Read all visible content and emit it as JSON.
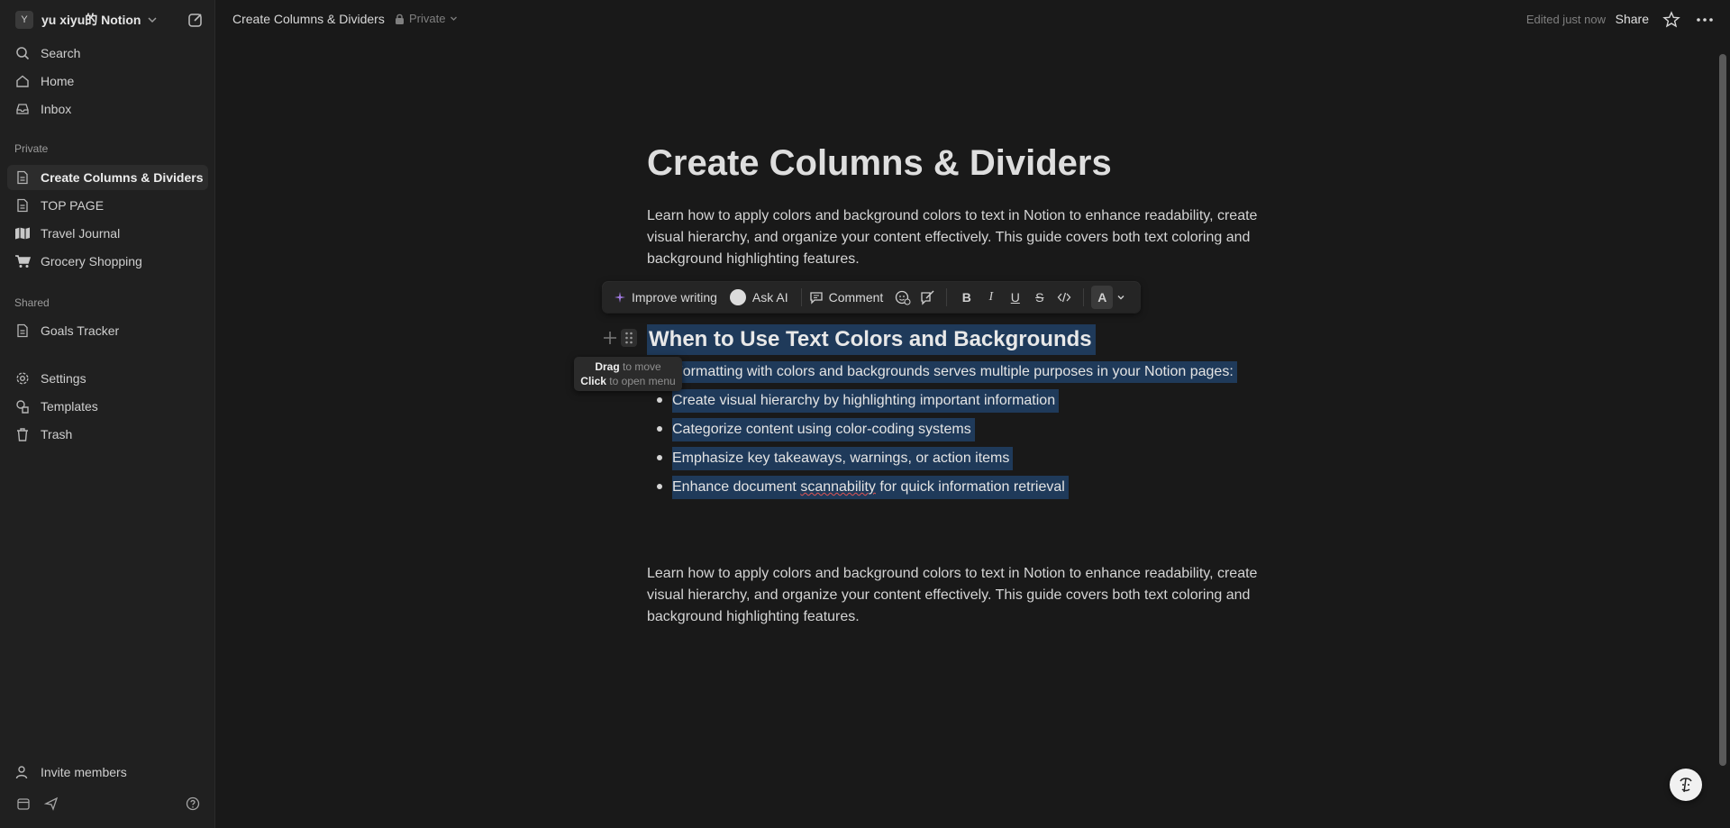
{
  "workspace": {
    "avatar_letter": "Y",
    "name": "yu xiyu的 Notion"
  },
  "sidebar": {
    "top_items": [
      {
        "label": "Search",
        "icon": "search-icon"
      },
      {
        "label": "Home",
        "icon": "home-icon"
      },
      {
        "label": "Inbox",
        "icon": "inbox-icon"
      }
    ],
    "private_label": "Private",
    "private_items": [
      {
        "label": "Create Columns & Dividers",
        "icon": "page-icon",
        "active": true
      },
      {
        "label": "TOP PAGE",
        "icon": "page-icon"
      },
      {
        "label": "Travel Journal",
        "icon": "map-icon"
      },
      {
        "label": "Grocery Shopping",
        "icon": "cart-icon"
      }
    ],
    "shared_label": "Shared",
    "shared_items": [
      {
        "label": "Goals Tracker",
        "icon": "page-icon"
      }
    ],
    "bottom_items": [
      {
        "label": "Settings",
        "icon": "gear-icon"
      },
      {
        "label": "Templates",
        "icon": "templates-icon"
      },
      {
        "label": "Trash",
        "icon": "trash-icon"
      }
    ],
    "invite_label": "Invite members"
  },
  "topbar": {
    "breadcrumb": "Create Columns & Dividers",
    "privacy": "Private",
    "edited": "Edited just now",
    "share": "Share"
  },
  "page": {
    "title": "Create Columns & Dividers",
    "intro_line1": "Learn how to apply colors and background colors to text in Notion to enhance readability, create",
    "intro_line2": "visual hierarchy, and organize your content effectively. This guide covers both text coloring and",
    "intro_line3": "background highlighting features.",
    "heading": "When to Use Text Colors and Backgrounds",
    "selected_intro": "Formatting with colors and backgrounds serves multiple purposes in your Notion pages:",
    "bullets": [
      "Create visual hierarchy by highlighting important information",
      "Categorize content using color-coding systems",
      "Emphasize key takeaways, warnings, or action items"
    ],
    "bullet4_a": "Enhance document ",
    "bullet4_b": "scannability",
    "bullet4_c": " for quick information retrieval",
    "outro_line1": "Learn how to apply colors and background colors to text in Notion to enhance readability, create",
    "outro_line2": "visual hierarchy, and organize your content effectively. This guide covers both text coloring and",
    "outro_line3": "background highlighting features."
  },
  "toolbar": {
    "improve": "Improve writing",
    "ask_ai": "Ask AI",
    "comment": "Comment",
    "bold": "B",
    "italic": "I",
    "underline": "U",
    "strike": "S",
    "color": "A"
  },
  "tooltip": {
    "drag": "Drag",
    "drag_rest": " to move",
    "click": "Click",
    "click_rest": " to open menu"
  },
  "colors": {
    "selection": "#1f3a5a",
    "background": "#191919",
    "sidebar": "#202020"
  }
}
